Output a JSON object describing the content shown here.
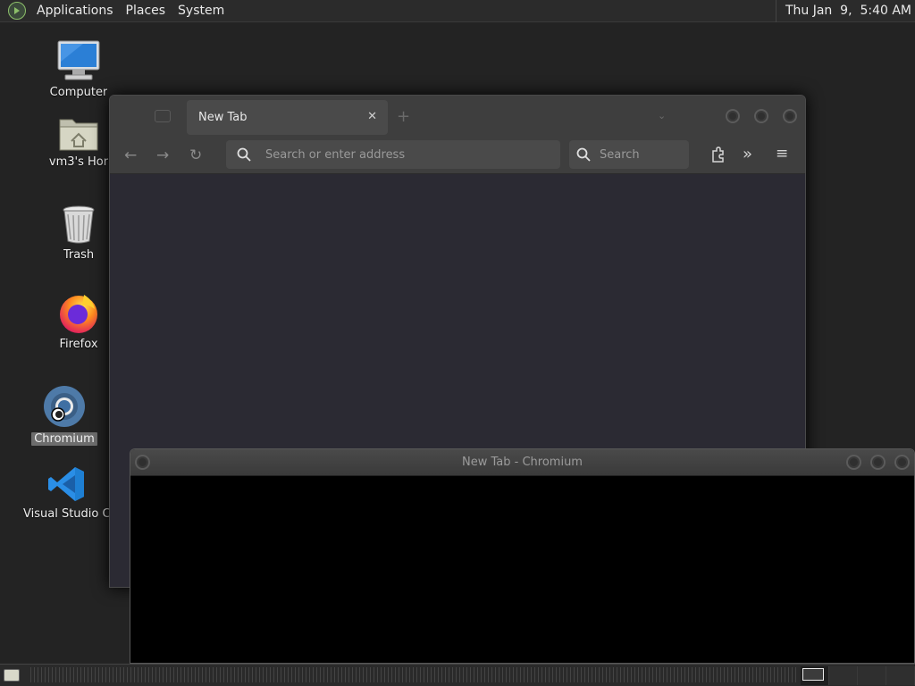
{
  "top_panel": {
    "menus": [
      "Applications",
      "Places",
      "System"
    ],
    "clock": "Thu Jan  9,  5:40 AM"
  },
  "desktop_icons": [
    {
      "label": "Computer",
      "icon": "computer-icon"
    },
    {
      "label": "vm3's Hor",
      "icon": "home-folder-icon"
    },
    {
      "label": "Trash",
      "icon": "trash-icon"
    },
    {
      "label": "Firefox",
      "icon": "firefox-icon"
    },
    {
      "label": "Chromium",
      "icon": "chromium-icon",
      "selected": true
    },
    {
      "label": "Visual Studio Co",
      "icon": "vscode-icon"
    }
  ],
  "browser": {
    "tab_title": "New Tab",
    "url_placeholder": "Search or enter address",
    "search_placeholder": "Search"
  },
  "chromium_window": {
    "title": "New Tab - Chromium"
  },
  "colors": {
    "desktop_bg": "#232323",
    "panel_bg": "#2b2b2b",
    "browser_content": "#2b2a33",
    "toolbar": "#3e3e3e",
    "vscode_blue": "#2a8ee6"
  }
}
